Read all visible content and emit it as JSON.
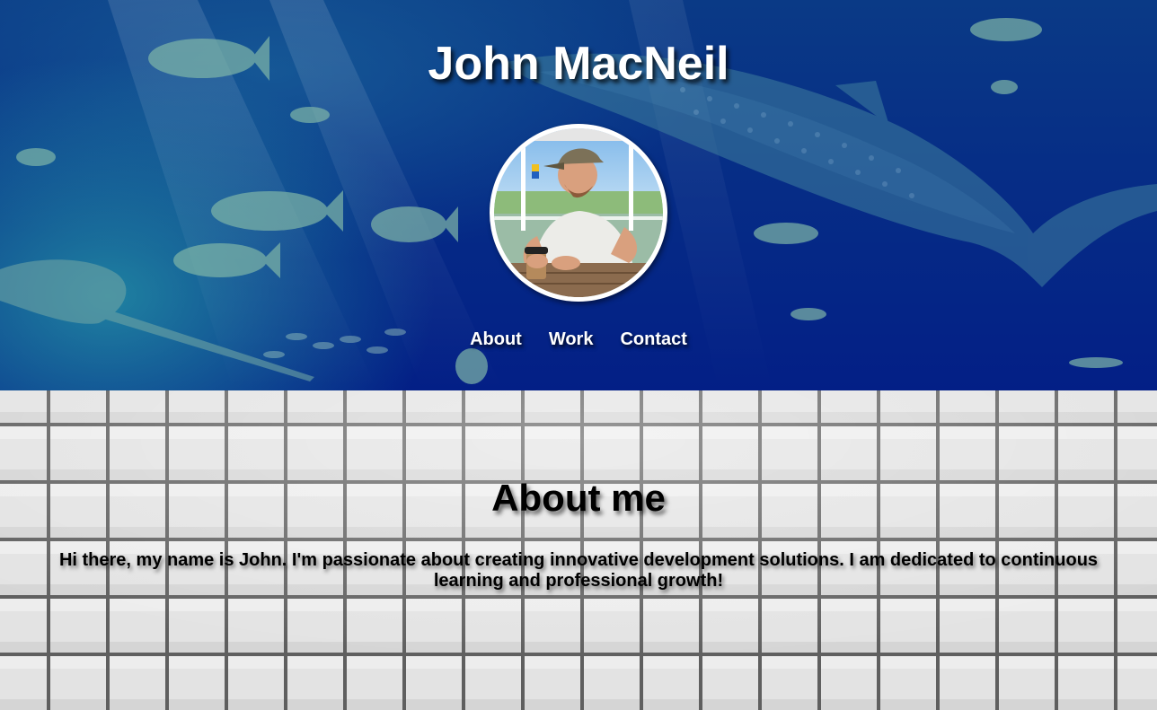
{
  "header": {
    "site_title": "John MacNeil",
    "nav": [
      {
        "label": "About"
      },
      {
        "label": "Work"
      },
      {
        "label": "Contact"
      }
    ]
  },
  "about": {
    "heading": "About me",
    "paragraph": "Hi there, my name is John. I'm passionate about creating innovative development solutions. I am dedicated to continuous learning and professional growth!"
  },
  "colors": {
    "hero_deep_blue": "#031f86",
    "hero_teal": "#28a0aa",
    "text_light": "#ffffff",
    "text_dark": "#000000",
    "tile_light": "#e6e6e6",
    "tile_grout": "#6e6e6e"
  }
}
